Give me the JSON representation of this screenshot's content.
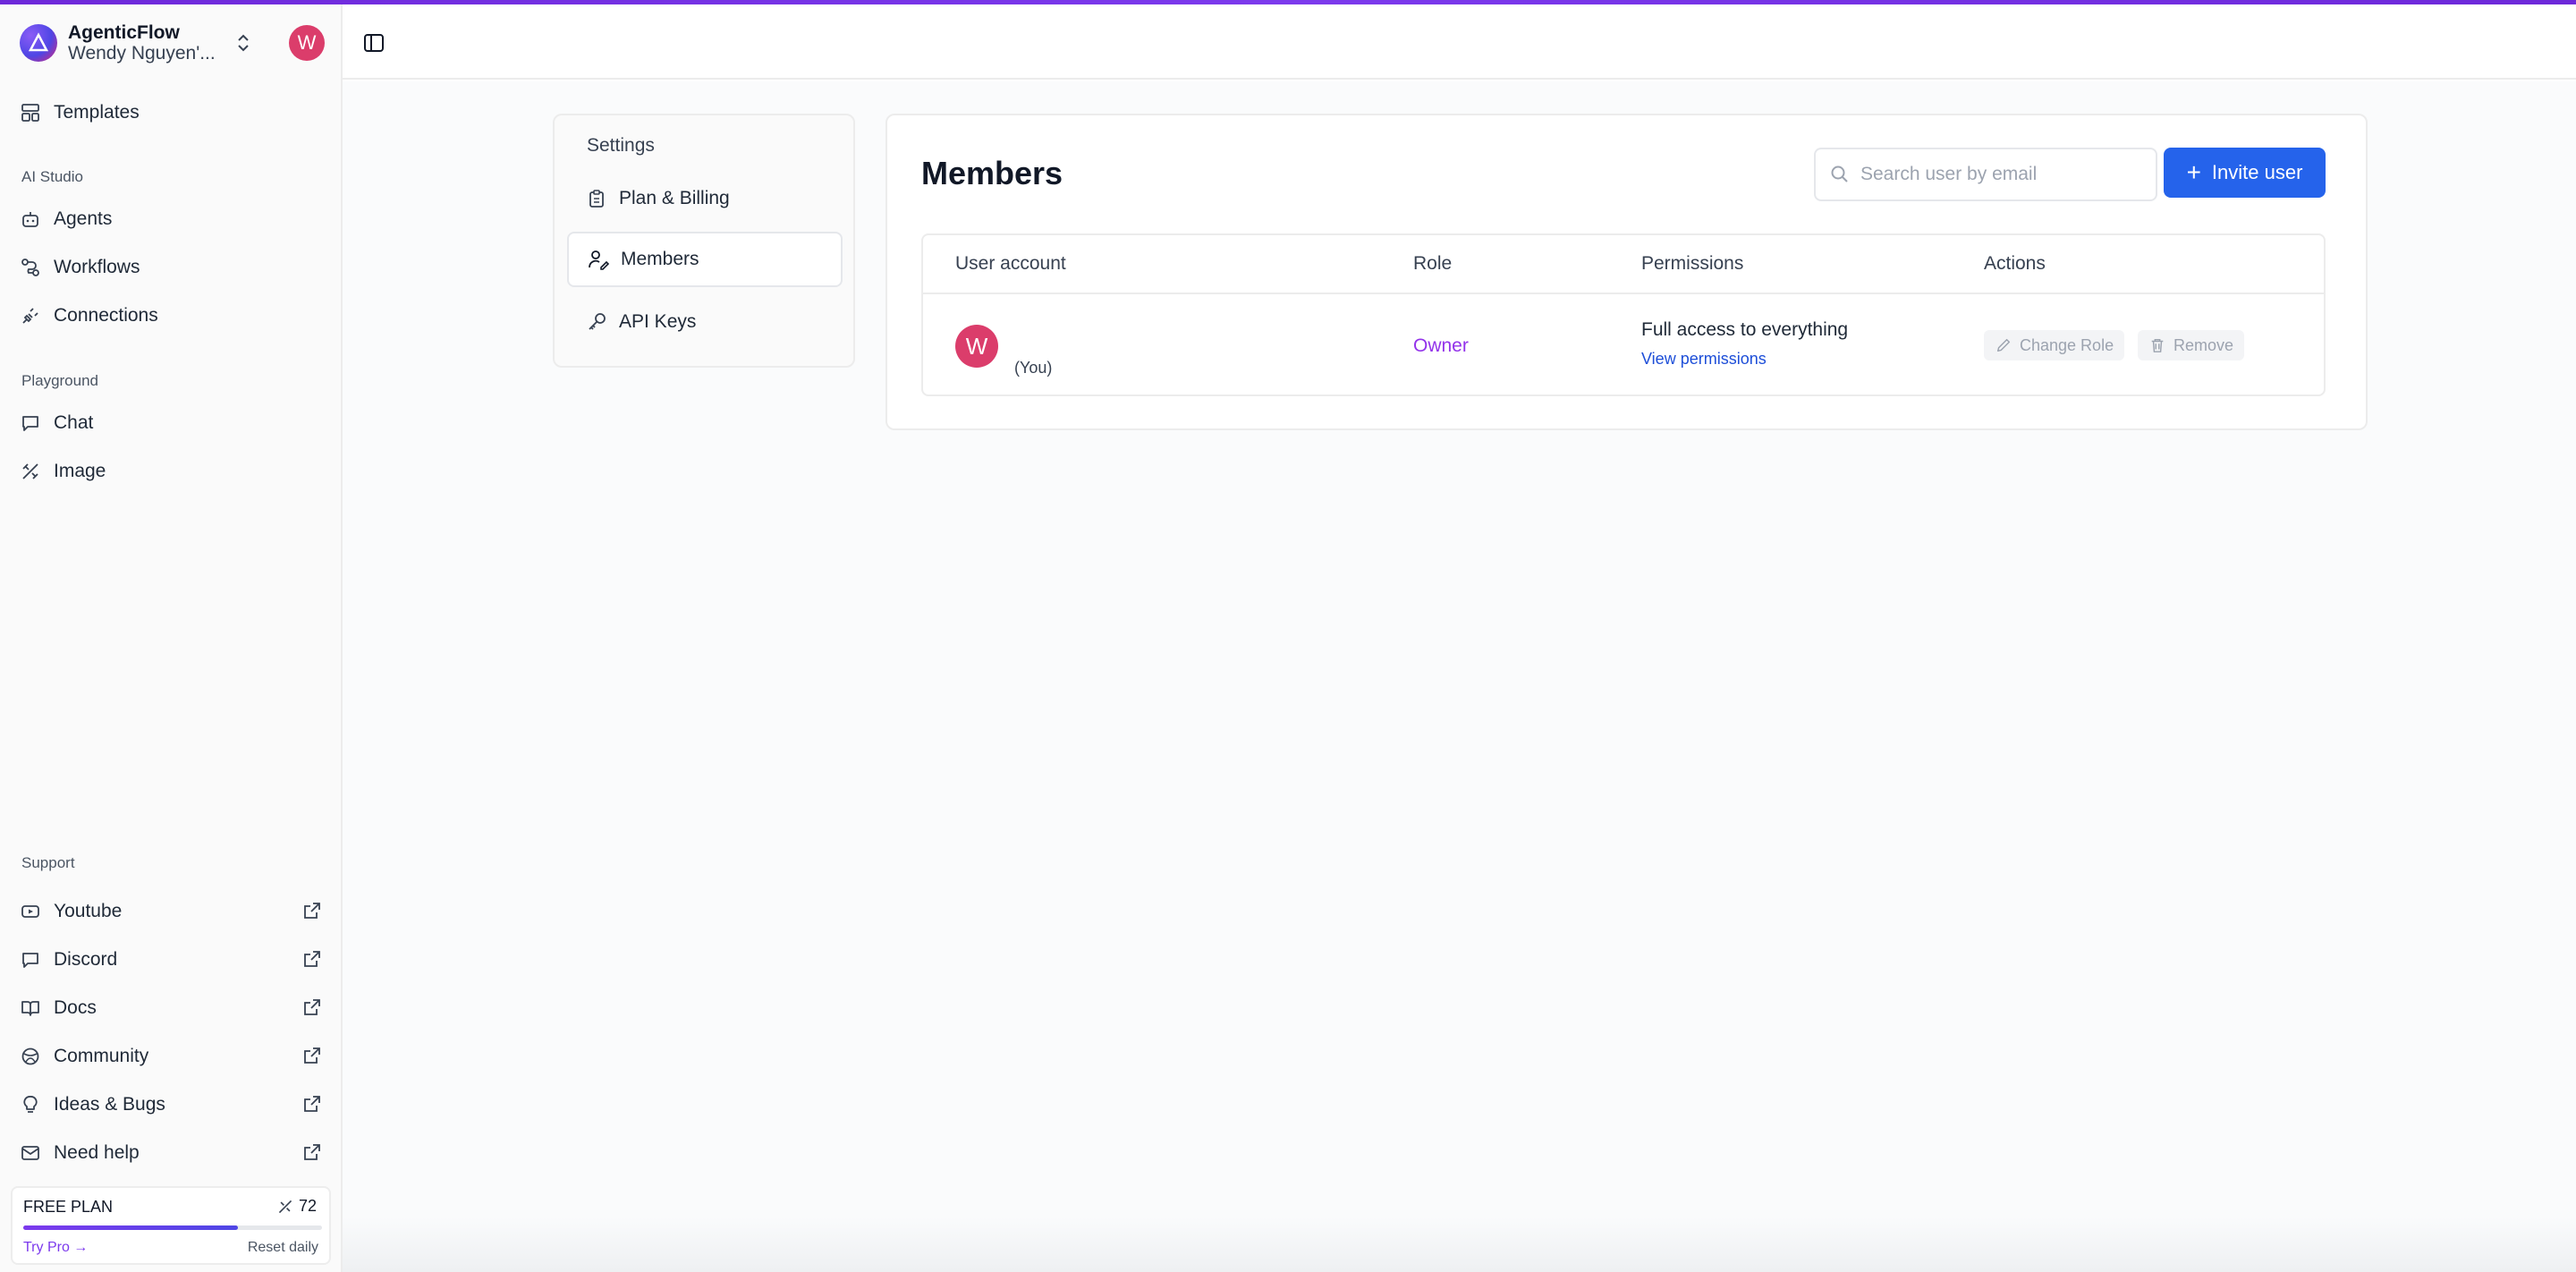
{
  "brand": {
    "name": "AgenticFlow",
    "workspace": "Wendy Nguyen'...",
    "avatar_letter": "W"
  },
  "sidebar": {
    "templates": "Templates",
    "sections": {
      "ai_studio": "AI Studio",
      "playground": "Playground",
      "support": "Support"
    },
    "ai_studio_items": [
      "Agents",
      "Workflows",
      "Connections"
    ],
    "playground_items": [
      "Chat",
      "Image"
    ],
    "support_items": [
      "Youtube",
      "Discord",
      "Docs",
      "Community",
      "Ideas & Bugs",
      "Need help"
    ]
  },
  "plan": {
    "title": "FREE PLAN",
    "credits": "72",
    "try_pro": "Try Pro →",
    "reset": "Reset daily",
    "usage_fraction": 0.72
  },
  "settings": {
    "title": "Settings",
    "items": [
      "Plan & Billing",
      "Members",
      "API Keys"
    ],
    "active": "Members"
  },
  "members": {
    "title": "Members",
    "search_placeholder": "Search user by email",
    "invite_label": "Invite user",
    "columns": [
      "User account",
      "Role",
      "Permissions",
      "Actions"
    ],
    "rows": [
      {
        "avatar_letter": "W",
        "you_label": "(You)",
        "role": "Owner",
        "permissions": "Full access to everything",
        "permissions_link": "View permissions",
        "actions": [
          "Change Role",
          "Remove"
        ]
      }
    ]
  },
  "colors": {
    "accent": "#2563eb",
    "role": "#9333ea",
    "avatar": "#db3d6b",
    "topline": "#7c3aed"
  }
}
